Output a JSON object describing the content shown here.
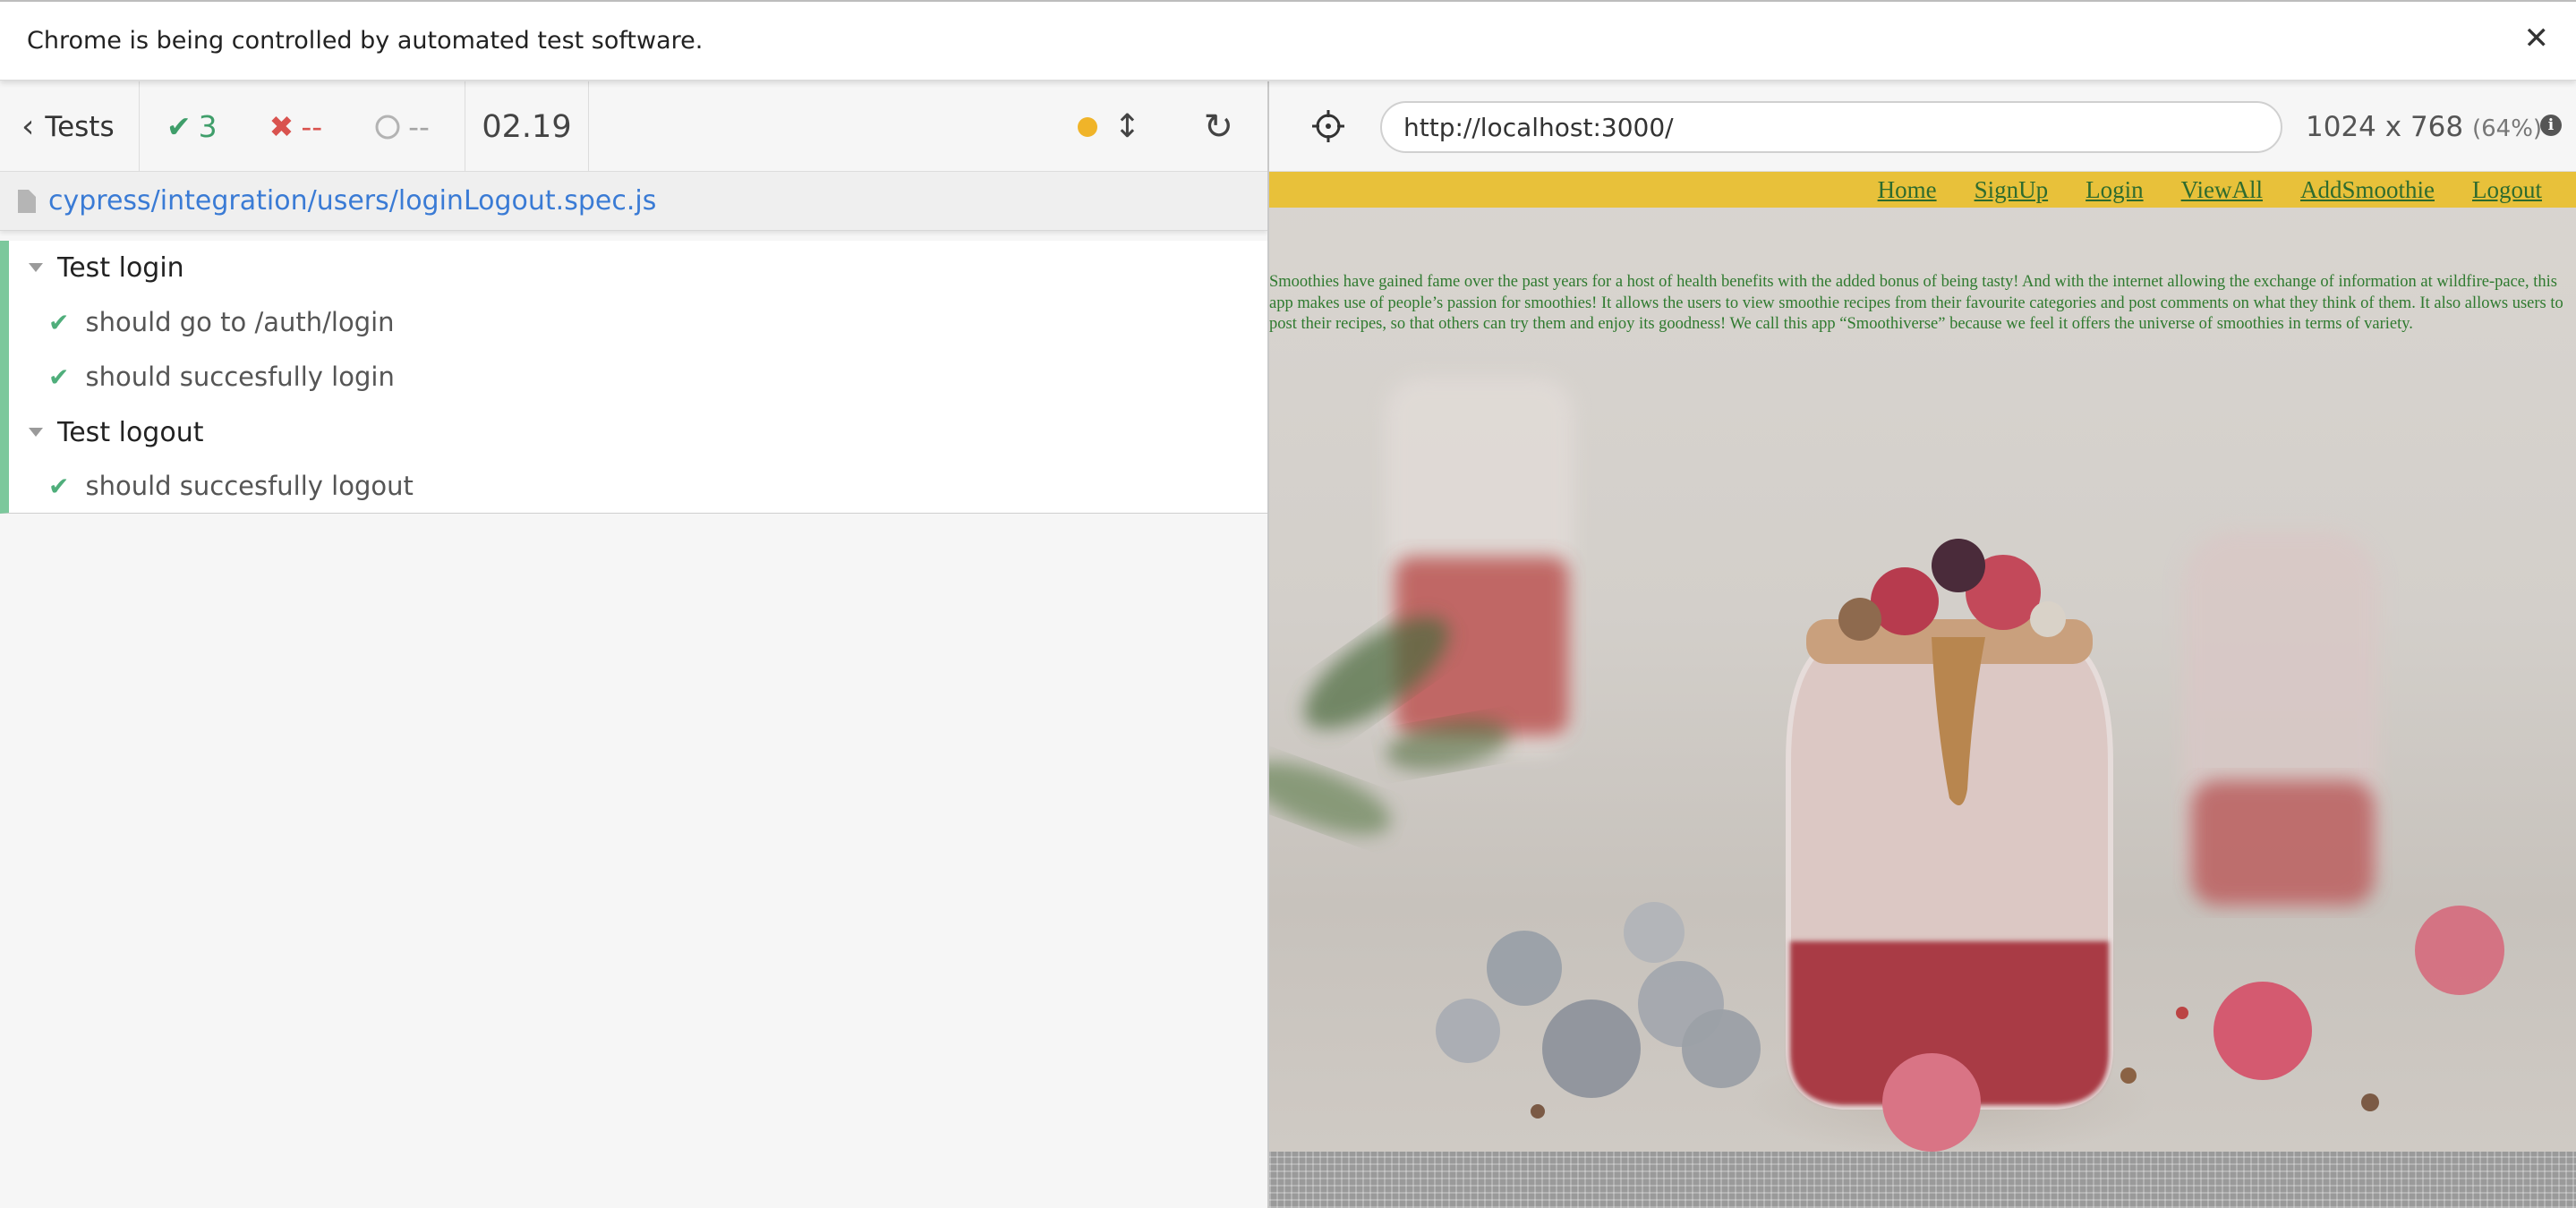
{
  "infobar": {
    "message": "Chrome is being controlled by automated test software.",
    "close_label": "✕"
  },
  "reporter": {
    "tests_label": "Tests",
    "stats": {
      "passed": "3",
      "failed": "--",
      "pending": "--",
      "duration": "02.19"
    },
    "spec_path": "cypress/integration/users/loginLogout.spec.js",
    "suites": [
      {
        "title": "Test login",
        "tests": [
          "should go to /auth/login",
          "should succesfully login"
        ]
      },
      {
        "title": "Test logout",
        "tests": [
          "should succesfully logout"
        ]
      }
    ]
  },
  "aut": {
    "url": "http://localhost:3000/",
    "viewport": "1024 x 768",
    "zoom": "(64%)",
    "nav": [
      "Home",
      "SignUp",
      "Login",
      "ViewAll",
      "AddSmoothie",
      "Logout"
    ],
    "about": "Smoothies have gained fame over the past years for a host of health benefits with the added bonus of being tasty! And with the internet allowing the exchange of information at wildfire-pace, this app makes use of people’s passion for smoothies! It allows the users to view smoothie recipes from their favourite categories and post comments on what they think of them. It also allows users to post their recipes, so that others can try them and enjoy its goodness! We call this app “Smoothiverse” because we feel it offers the universe of smoothies in terms of variety."
  },
  "colors": {
    "pass": "#4fae7b",
    "fail": "#d9534f",
    "link": "#3a7bd5",
    "navbar": "#e8c13a",
    "nav_text": "#2e6b2e"
  }
}
